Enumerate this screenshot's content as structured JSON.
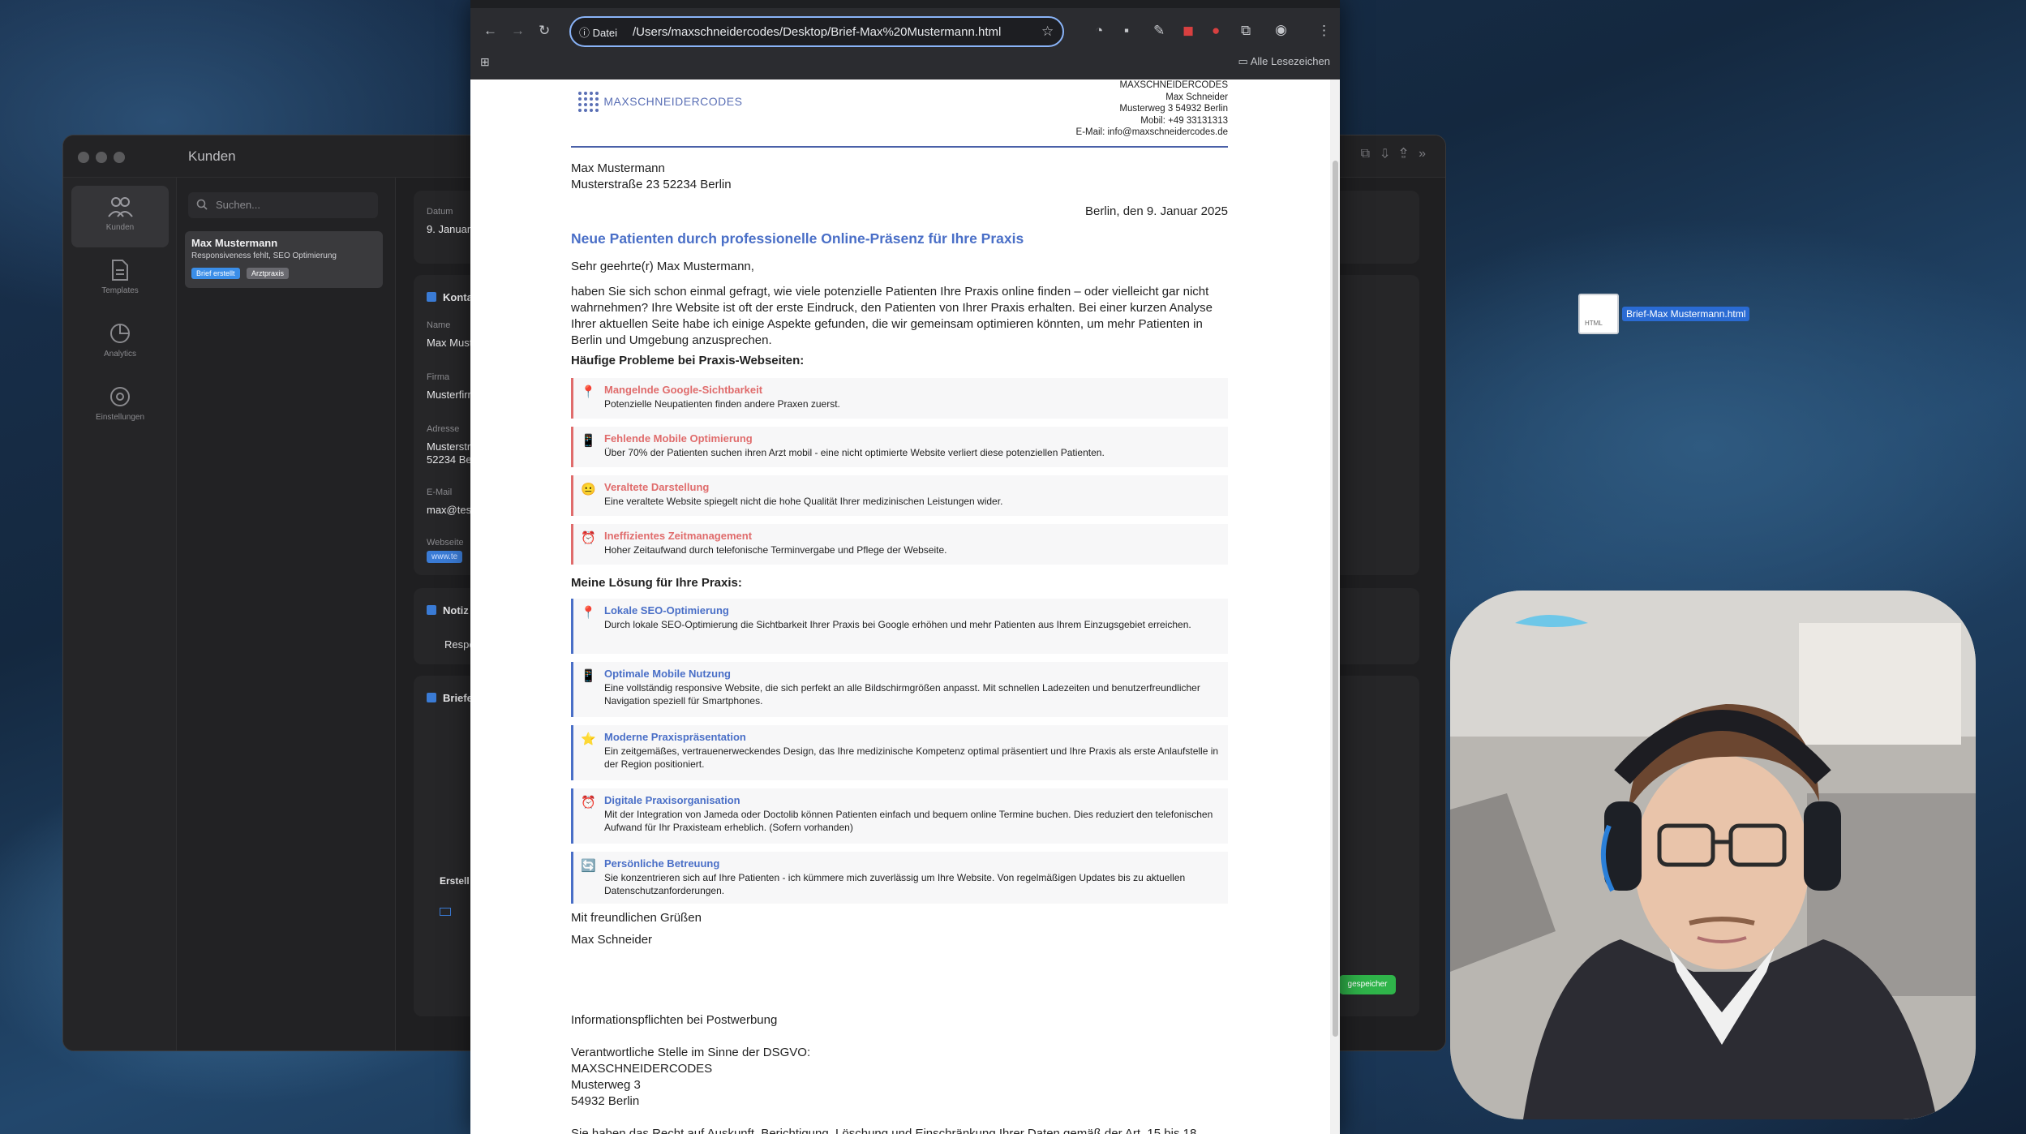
{
  "app": {
    "title": "Kunden",
    "rail": [
      {
        "label": "Kunden",
        "icon": "people-icon"
      },
      {
        "label": "Templates",
        "icon": "document-icon"
      },
      {
        "label": "Analytics",
        "icon": "chart-icon"
      },
      {
        "label": "Einstellungen",
        "icon": "settings-icon"
      }
    ],
    "search_placeholder": "Suchen...",
    "customer": {
      "name": "Max Mustermann",
      "sub": "Responsiveness fehlt, SEO Optimierung",
      "chips": [
        "Brief erstellt",
        "Arztpraxis"
      ]
    },
    "detail": {
      "datum_label": "Datum",
      "datum_value": "9. Januar 2",
      "kontakt_title": "Konta",
      "name_label": "Name",
      "name_value": "Max Muste",
      "firma_label": "Firma",
      "firma_value": "Musterfirm",
      "adresse_label": "Adresse",
      "adresse_value1": "Musterstr",
      "adresse_value2": "52234 Ber",
      "email_label": "E-Mail",
      "email_value": "max@test",
      "website_label": "Webseite",
      "website_value": "www.te",
      "notiz_title": "Notiz",
      "notiz_value": "Respon",
      "briefe_title": "Briefe",
      "erstellt_label": "Erstell",
      "saved_label": "gespeicher"
    }
  },
  "browser": {
    "url_badge": "Datei",
    "url": "/Users/maxschneidercodes/Desktop/Brief-Max%20Mustermann.html",
    "bookmarks_label": "Alle Lesezeichen"
  },
  "letter": {
    "logo": "MAXSCHNEIDERCODES",
    "sender": [
      "MAXSCHNEIDERCODES",
      "Max Schneider",
      "Musterweg 3 54932 Berlin",
      "Mobil: +49 33131313",
      "E-Mail: info@maxschneidercodes.de"
    ],
    "recipient": [
      "Max Mustermann",
      "Musterstraße 23 52234 Berlin"
    ],
    "date": "Berlin, den 9. Januar 2025",
    "subject": "Neue Patienten durch professionelle Online-Präsenz für Ihre Praxis",
    "salutation": "Sehr geehrte(r) Max Mustermann,",
    "intro": "haben Sie sich schon einmal gefragt, wie viele potenzielle Patienten Ihre Praxis online finden – oder vielleicht gar nicht wahrnehmen? Ihre Website ist oft der erste Eindruck, den Patienten von Ihrer Praxis erhalten. Bei einer kurzen Analyse Ihrer aktuellen Seite habe ich einige Aspekte gefunden, die wir gemeinsam optimieren könnten, um mehr Patienten in Berlin und Umgebung anzusprechen.",
    "problems_heading": "Häufige Probleme bei Praxis-Webseiten:",
    "problems": [
      {
        "icon": "📍",
        "title": "Mangelnde Google-Sichtbarkeit",
        "desc": "Potenzielle Neupatienten finden andere Praxen zuerst."
      },
      {
        "icon": "📱",
        "title": "Fehlende Mobile Optimierung",
        "desc": "Über 70% der Patienten suchen ihren Arzt mobil - eine nicht optimierte Website verliert diese potenziellen Patienten."
      },
      {
        "icon": "😐",
        "title": "Veraltete Darstellung",
        "desc": "Eine veraltete Website spiegelt nicht die hohe Qualität Ihrer medizinischen Leistungen wider."
      },
      {
        "icon": "⏰",
        "title": "Ineffizientes Zeitmanagement",
        "desc": "Hoher Zeitaufwand durch telefonische Terminvergabe und Pflege der Webseite."
      }
    ],
    "solutions_heading": "Meine Lösung für Ihre Praxis:",
    "solutions": [
      {
        "icon": "📍",
        "title": "Lokale SEO-Optimierung",
        "desc": "Durch lokale SEO-Optimierung die Sichtbarkeit Ihrer Praxis bei Google erhöhen und mehr Patienten aus Ihrem Einzugsgebiet erreichen."
      },
      {
        "icon": "📱",
        "title": "Optimale Mobile Nutzung",
        "desc": "Eine vollständig responsive Website, die sich perfekt an alle Bildschirmgrößen anpasst. Mit schnellen Ladezeiten und benutzerfreundlicher Navigation speziell für Smartphones."
      },
      {
        "icon": "⭐",
        "title": "Moderne Praxispräsentation",
        "desc": "Ein zeitgemäßes, vertrauenerweckendes Design, das Ihre medizinische Kompetenz optimal präsentiert und Ihre Praxis als erste Anlaufstelle in der Region positioniert."
      },
      {
        "icon": "⏰",
        "title": "Digitale Praxisorganisation",
        "desc": "Mit der Integration von Jameda oder Doctolib können Patienten einfach und bequem online Termine buchen. Dies reduziert den telefonischen Aufwand für Ihr Praxisteam erheblich. (Sofern vorhanden)"
      },
      {
        "icon": "🔄",
        "title": "Persönliche Betreuung",
        "desc": "Sie konzentrieren sich auf Ihre Patienten - ich kümmere mich zuverlässig um Ihre Website. Von regelmäßigen Updates bis zu aktuellen Datenschutzanforderungen."
      }
    ],
    "greeting": "Mit freundlichen Grüßen",
    "signature": "Max Schneider",
    "info_heading": "Informationspflichten bei Postwerbung",
    "dsgvo": [
      "Verantwortliche Stelle im Sinne der DSGVO:",
      "MAXSCHNEIDERCODES",
      "Musterweg 3",
      "54932 Berlin"
    ],
    "cut_line": "Sie haben das Recht auf Auskunft, Berichtigung, Löschung und Einschränkung Ihrer Daten gemäß der Art. 15 bis 18"
  },
  "desktop_file": {
    "name": "Brief-Max Mustermann.html",
    "ext": "HTML"
  },
  "colors": {
    "problem_accent": "#e06c6c",
    "solution_accent": "#4a6fc7",
    "url_focus": "#8ab4f8"
  }
}
